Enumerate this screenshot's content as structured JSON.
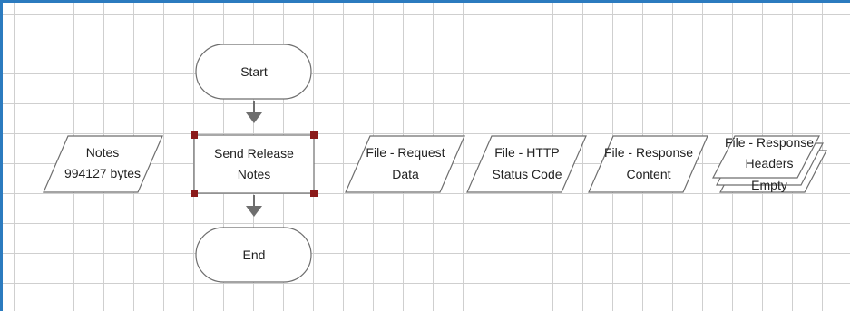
{
  "flowchart": {
    "start": {
      "label": "Start"
    },
    "process": {
      "lines": [
        "Send Release",
        "Notes"
      ],
      "selected": true
    },
    "end": {
      "label": "End"
    },
    "notes": {
      "lines": [
        "Notes",
        "994127 bytes"
      ]
    },
    "request_data": {
      "lines": [
        "File - Request",
        "Data"
      ]
    },
    "status_code": {
      "lines": [
        "File - HTTP",
        "Status Code"
      ]
    },
    "response_content": {
      "lines": [
        "File - Response",
        "Content"
      ]
    },
    "response_headers": {
      "lines": [
        "File - Response",
        "Headers",
        "Empty"
      ]
    }
  },
  "colors": {
    "frame": "#2b7bbf",
    "grid": "#cfcfcf",
    "shape_fill": "#ffffff",
    "shape_stroke": "#6e6e6e",
    "connector": "#6e6e6e",
    "selection_handle": "#8b1a1a"
  }
}
